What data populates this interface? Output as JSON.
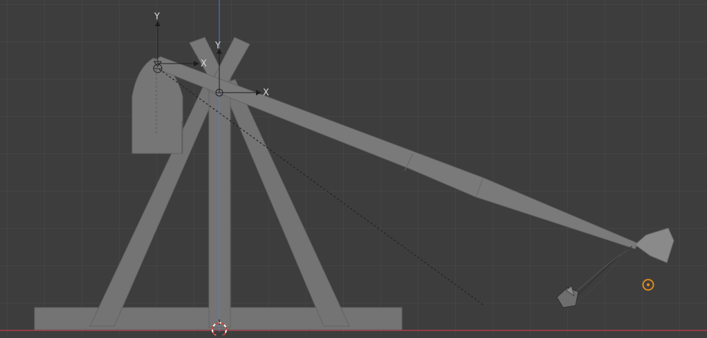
{
  "viewport": {
    "background_color": "#3d3d3d",
    "grid_color": "#4b4b4b",
    "view": "orthographic-side"
  },
  "axes": {
    "world_z_axis_color": "#4a7fd4",
    "ground_line_color": "#b23b4a"
  },
  "gizmos": {
    "counterweight_pivot": {
      "y_label": "Y",
      "x_label": "X"
    },
    "arm_pivot": {
      "y_label": "Y",
      "x_label": "X"
    }
  },
  "colors": {
    "mesh_fill": "#747474",
    "mesh_edge": "#626262",
    "object_origin_selected": "#e08a1c",
    "cursor_red": "#c8423b",
    "cursor_white": "#ffffff"
  }
}
